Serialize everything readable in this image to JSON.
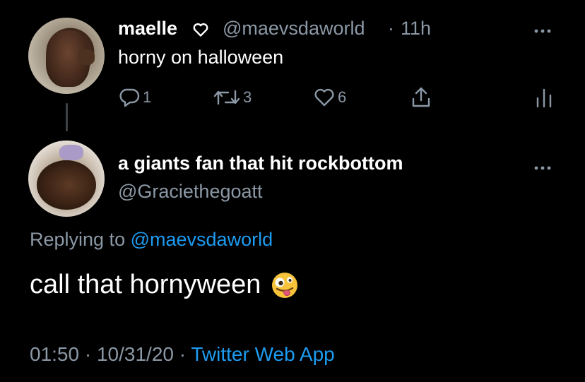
{
  "parent_tweet": {
    "display_name": "maelle",
    "handle": "@maevsdaworld",
    "separator": "·",
    "time": "11h",
    "text": "horny on halloween",
    "actions": {
      "reply_count": "1",
      "retweet_count": "3",
      "like_count": "6"
    },
    "icons": {
      "verified": "heart-outline-icon",
      "more": "more-horizontal-icon",
      "reply": "reply-icon",
      "retweet": "retweet-icon",
      "like": "heart-icon",
      "share": "share-icon",
      "analytics": "analytics-icon"
    }
  },
  "reply_tweet": {
    "display_name": "a giants fan that hit rockbottom",
    "handle": "@Graciethegoatt",
    "replying_prefix": "Replying to",
    "replying_to": "@maevsdaworld",
    "text": "call that hornyween",
    "emoji": "zany-face-emoji",
    "time": "01:50",
    "date": "10/31/20",
    "separator": "·",
    "source": "Twitter Web App"
  },
  "colors": {
    "background": "#000000",
    "primary_text": "#ffffff",
    "secondary_text": "#8b98a5",
    "link": "#1d9bf0"
  }
}
